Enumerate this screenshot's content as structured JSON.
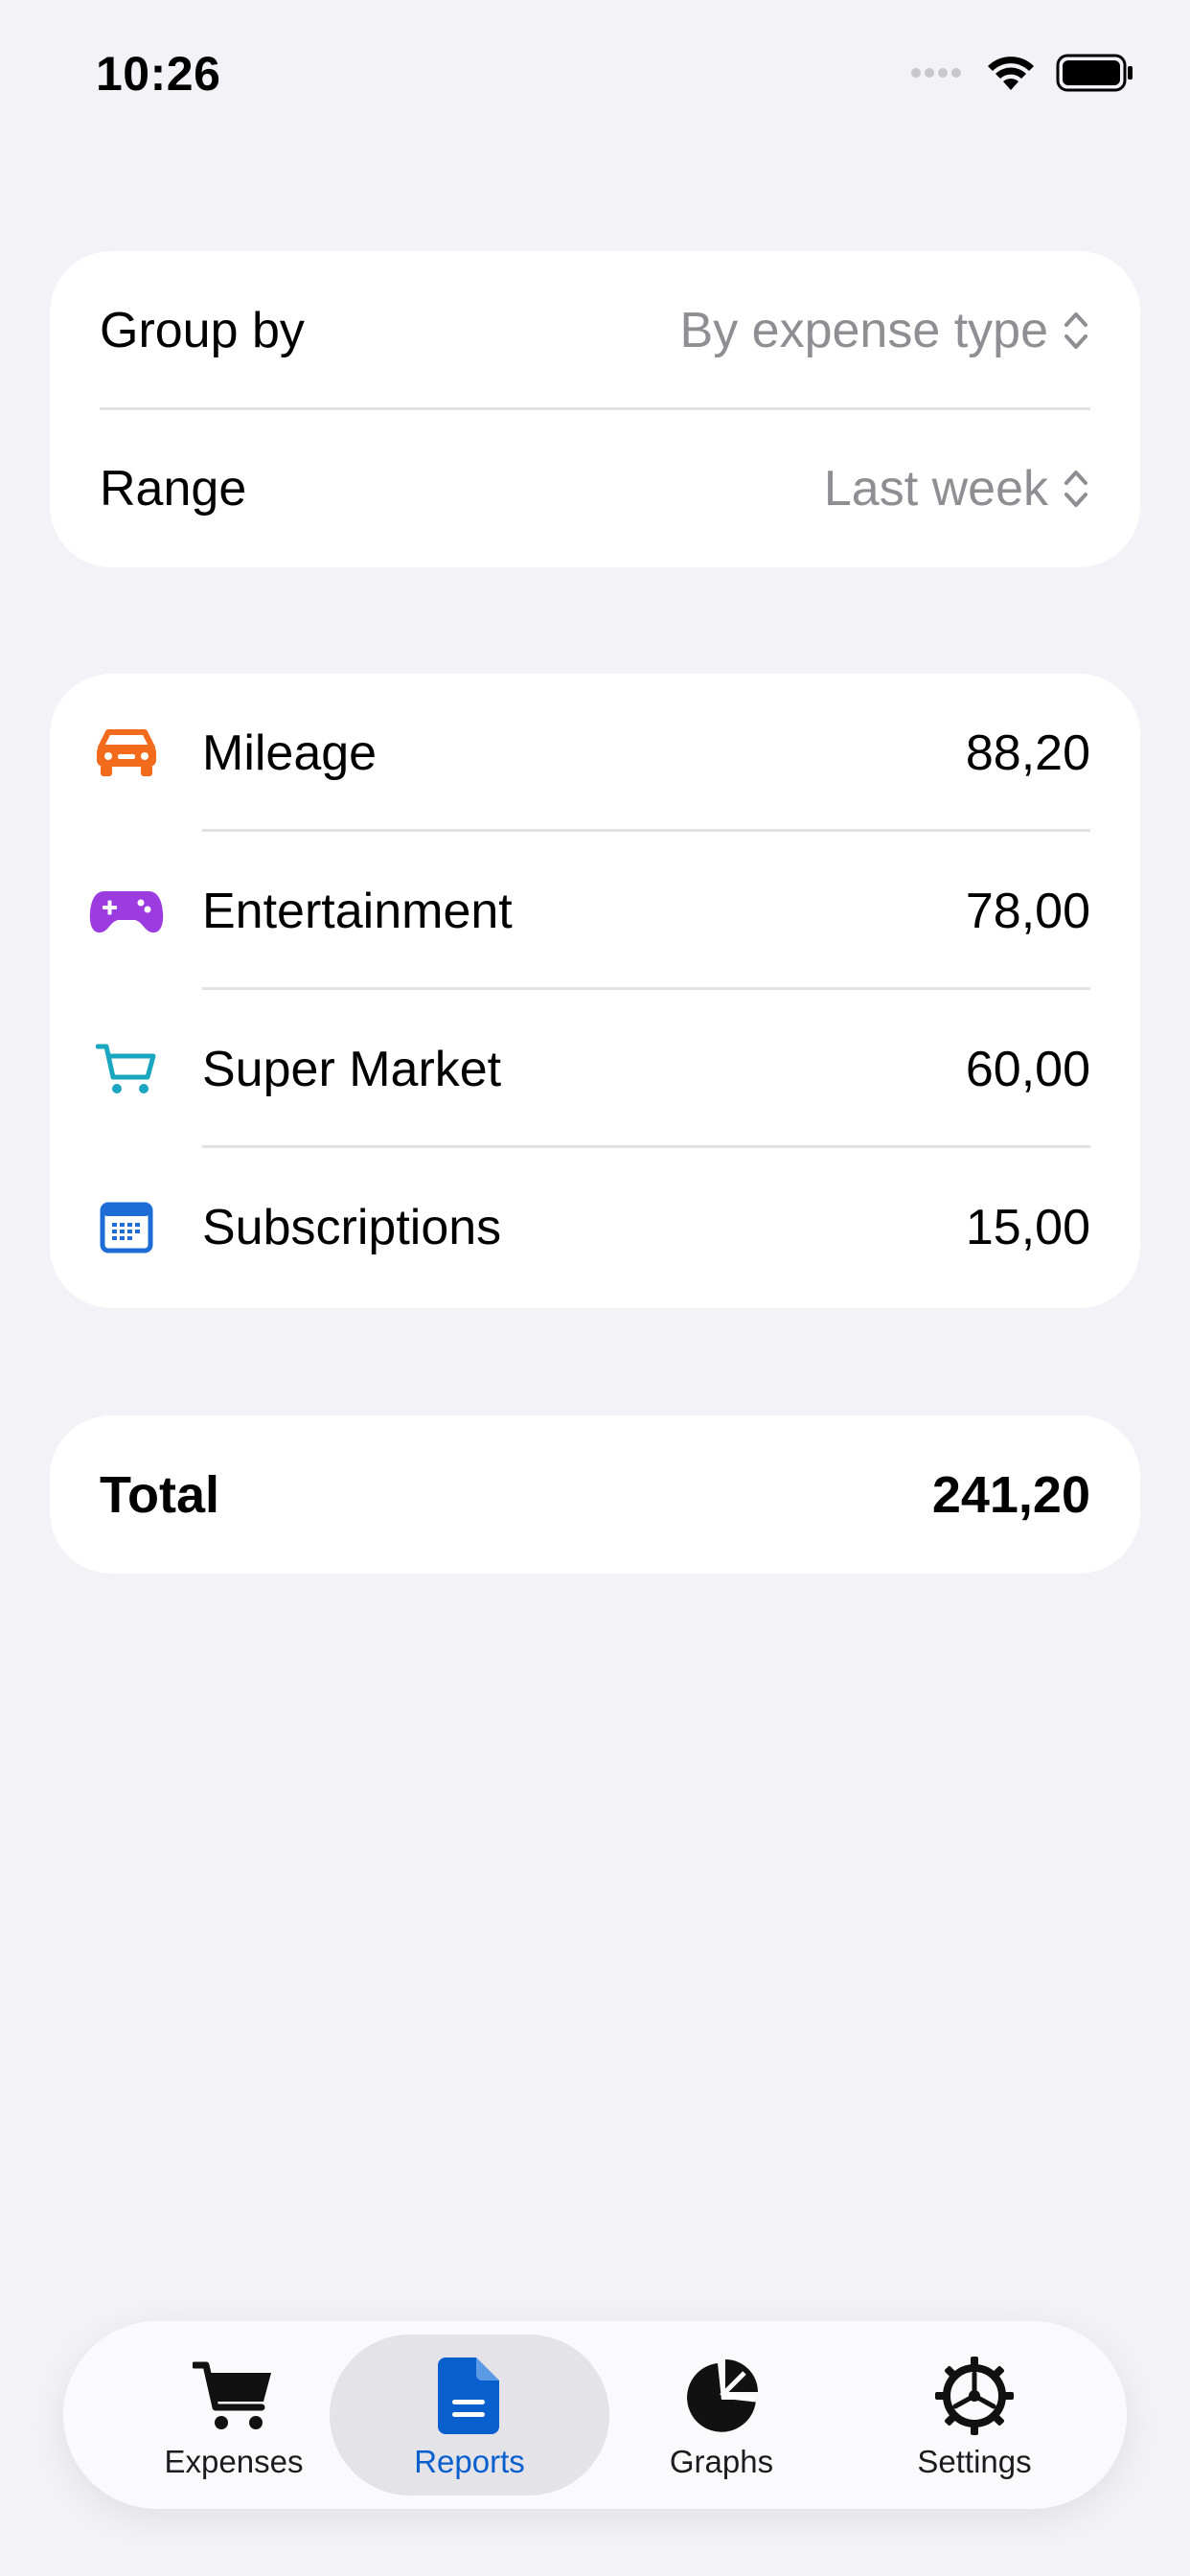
{
  "status_bar": {
    "time": "10:26"
  },
  "settings": {
    "group_by": {
      "label": "Group by",
      "value": "By expense type"
    },
    "range": {
      "label": "Range",
      "value": "Last week"
    }
  },
  "categories": [
    {
      "name": "Mileage",
      "amount": "88,20",
      "icon": "car-icon",
      "color": "#F26B1D"
    },
    {
      "name": "Entertainment",
      "amount": "78,00",
      "icon": "gamecontroller-icon",
      "color": "#9B3BE0"
    },
    {
      "name": "Super Market",
      "amount": "60,00",
      "icon": "cart-icon",
      "color": "#1AA6BF"
    },
    {
      "name": "Subscriptions",
      "amount": "15,00",
      "icon": "calendar-icon",
      "color": "#1E6CD6"
    }
  ],
  "total": {
    "label": "Total",
    "amount": "241,20"
  },
  "tab_bar": {
    "tabs": [
      {
        "label": "Expenses",
        "icon": "cart-icon",
        "active": false
      },
      {
        "label": "Reports",
        "icon": "document-icon",
        "active": true
      },
      {
        "label": "Graphs",
        "icon": "pie-chart-icon",
        "active": false
      },
      {
        "label": "Settings",
        "icon": "gear-icon",
        "active": false
      }
    ]
  },
  "colors": {
    "background": "#F2F2F7",
    "card": "#FFFFFF",
    "accent": "#0A5FCF",
    "secondary_text": "#8E8E93"
  }
}
